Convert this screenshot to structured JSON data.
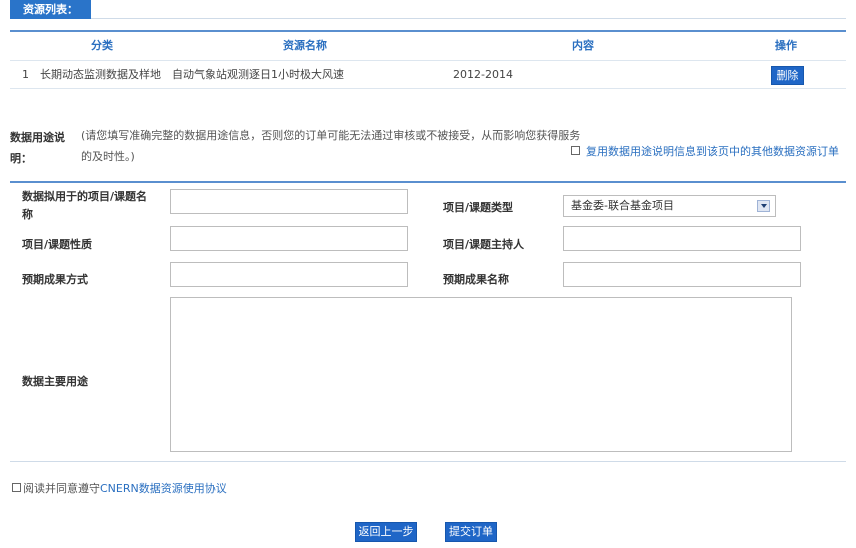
{
  "resource_list": {
    "title": "资源列表：",
    "headers": {
      "category": "分类",
      "name": "资源名称",
      "content": "内容",
      "action": "操作"
    },
    "rows": [
      {
        "index": "1",
        "category": "长期动态监测数据及样地",
        "name": "自动气象站观测逐日1小时极大风速",
        "content": "2012-2014",
        "delete_label": "删除"
      }
    ]
  },
  "usage_section": {
    "label_line1": "数据用途说",
    "label_line2": "明：",
    "note_line1": "(请您填写准确完整的数据用途信息，否则您的订单可能无法通过审核或不被接受，从而影响您获得服务",
    "note_line2": "的及时性。)",
    "reuse_label": "复用数据用途说明信息到该页中的其他数据资源订单"
  },
  "form": {
    "project_name_label_1": "数据拟用于的项目/课题名",
    "project_name_label_2": "称",
    "project_name_value": "",
    "project_type_label": "项目/课题类型",
    "project_type_value": "基金委-联合基金项目",
    "project_nature_label": "项目/课题性质",
    "project_nature_value": "",
    "project_leader_label": "项目/课题主持人",
    "project_leader_value": "",
    "result_method_label": "预期成果方式",
    "result_method_value": "",
    "result_name_label": "预期成果名称",
    "result_name_value": "",
    "main_usage_label": "数据主要用途",
    "main_usage_value": ""
  },
  "agreement": {
    "prefix": "阅读并同意遵守",
    "link": "CNERN数据资源使用协议"
  },
  "actions": {
    "back_label": "返回上一步",
    "submit_label": "提交订单"
  }
}
